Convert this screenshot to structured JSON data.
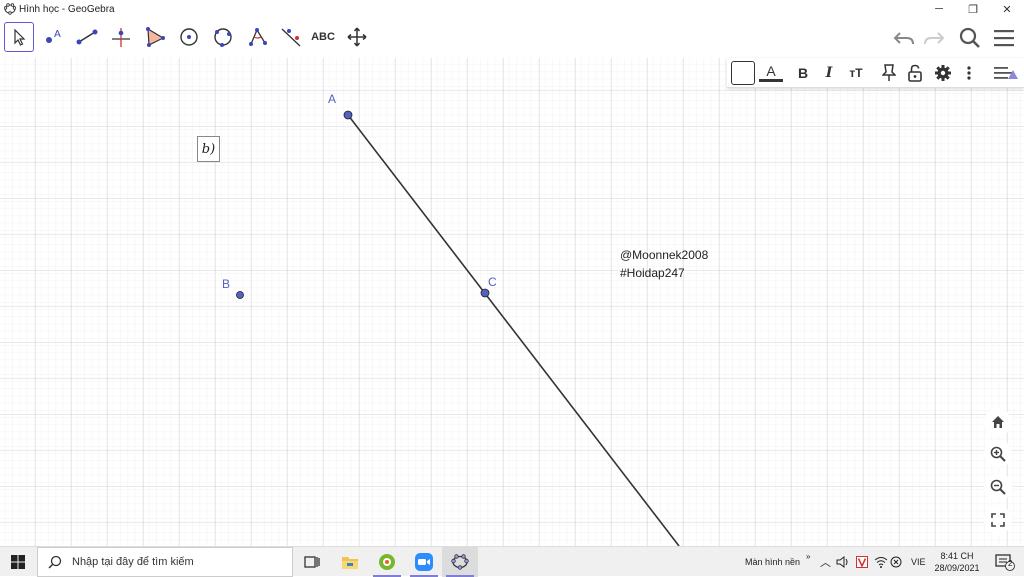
{
  "window": {
    "title": "Hình học - GeoGebra",
    "controls": [
      "minimize-icon",
      "restore-icon",
      "close-icon"
    ]
  },
  "toolbar": {
    "tools": [
      {
        "name": "move-tool",
        "icon": "pointer-arrow-icon",
        "active": true
      },
      {
        "name": "point-tool",
        "icon": "point-icon"
      },
      {
        "name": "segment-tool",
        "icon": "segment-icon"
      },
      {
        "name": "perpendicular-line-tool",
        "icon": "perpendicular-icon"
      },
      {
        "name": "polygon-tool",
        "icon": "polygon-icon"
      },
      {
        "name": "circle-center-point-tool",
        "icon": "circle-center-icon"
      },
      {
        "name": "circle-three-points-tool",
        "icon": "circle-three-points-icon"
      },
      {
        "name": "angle-tool",
        "icon": "angle-icon"
      },
      {
        "name": "reflect-tool",
        "icon": "reflect-icon"
      },
      {
        "name": "text-tool",
        "label": "ABC"
      },
      {
        "name": "move-graphics-view-tool",
        "icon": "move-arrows-icon"
      }
    ],
    "right": [
      "undo-icon",
      "redo-icon",
      "search-icon",
      "menu-icon"
    ]
  },
  "style_bar": {
    "bold": "B",
    "italic": "I",
    "text_size": "тT",
    "text_color": "A"
  },
  "canvas": {
    "points": [
      {
        "label": "A"
      },
      {
        "label": "B"
      },
      {
        "label": "C"
      }
    ],
    "text_box": "b)",
    "watermark_lines": [
      "@Moonnek2008",
      "#Hoidap247"
    ]
  },
  "zoom_controls": [
    "home-icon",
    "zoom-in-icon",
    "zoom-out-icon",
    "fullscreen-icon"
  ],
  "taskbar": {
    "search_placeholder": "Nhập tại đây để tìm kiếm",
    "tray_label": "Màn hình nền",
    "language": "VIE",
    "time": "8:41 CH",
    "date": "28/09/2021",
    "notifications": "2"
  },
  "colors": {
    "point": "#5560c5",
    "line": "#333333",
    "grid": "#e6e6e6",
    "active_tool": "#6557d2"
  }
}
